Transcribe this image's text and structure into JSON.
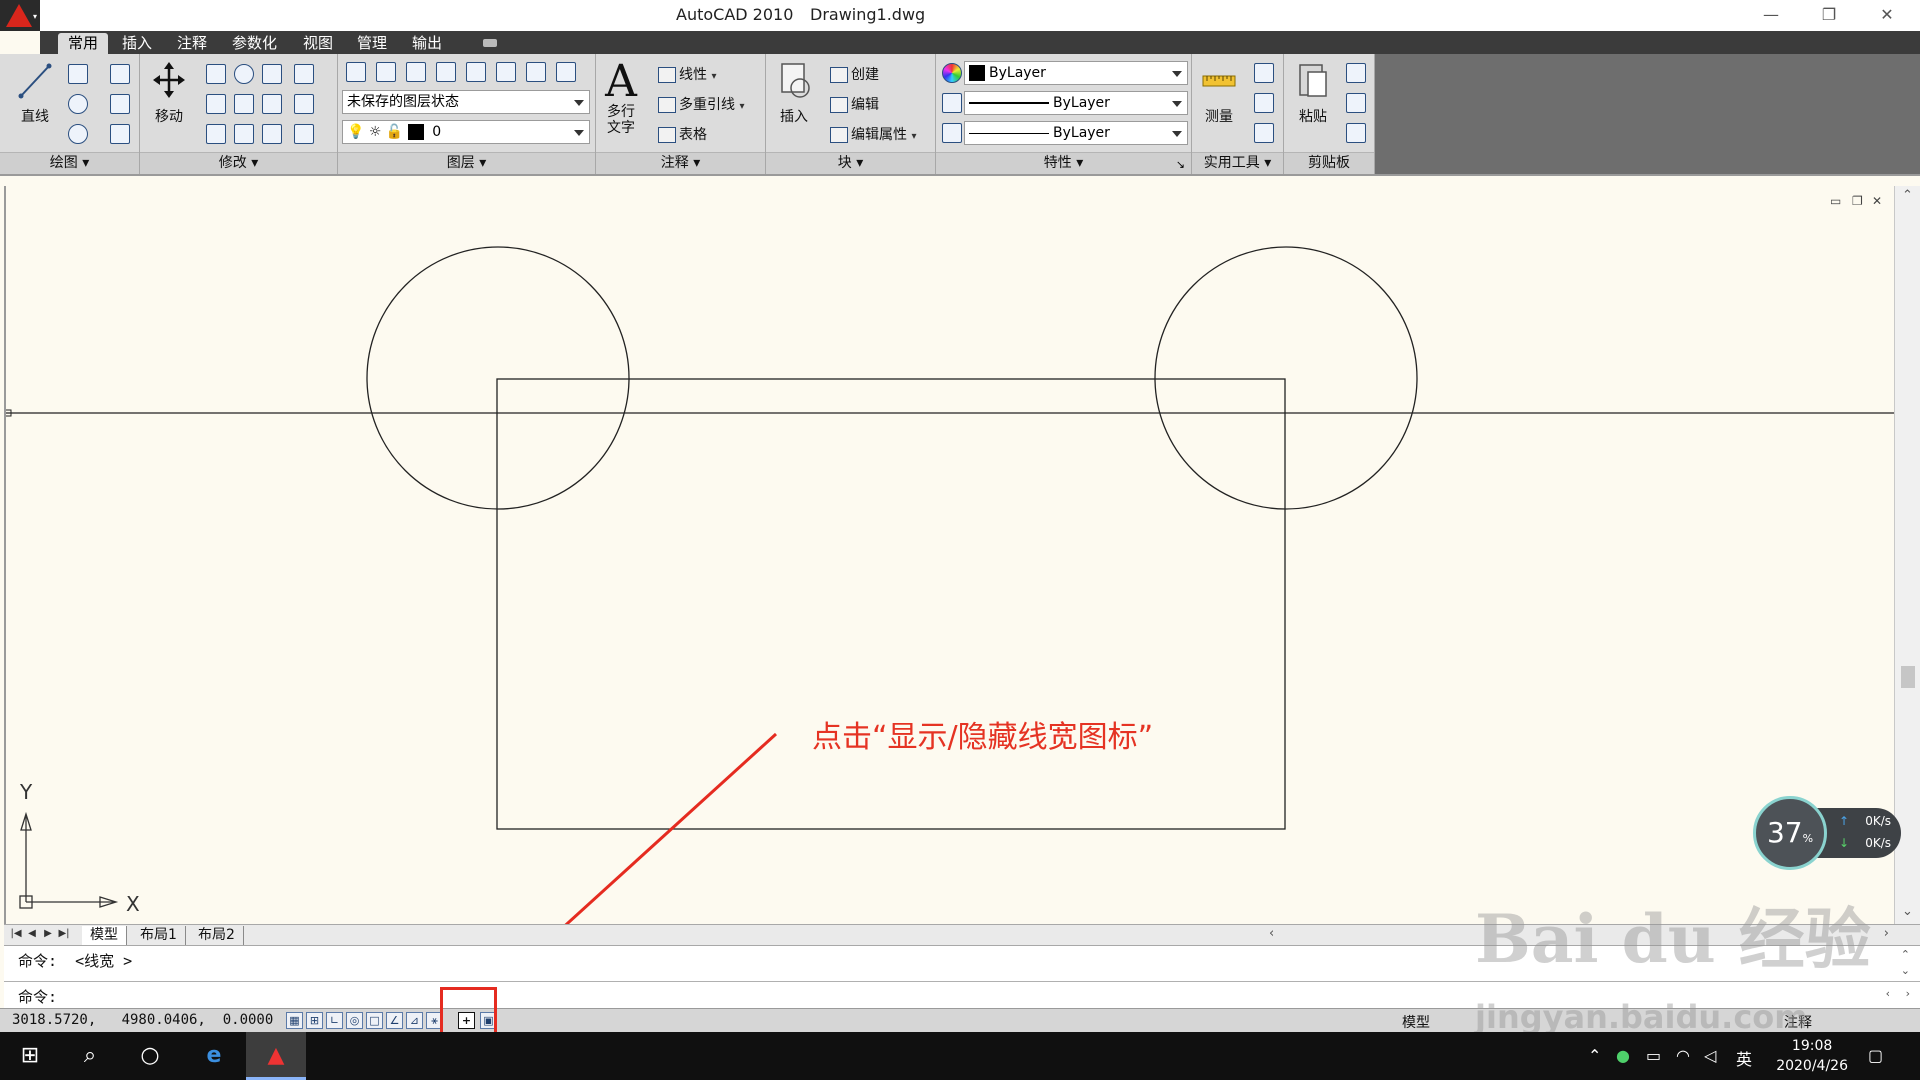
{
  "window": {
    "app_name": "AutoCAD 2010",
    "doc_name": "Drawing1.dwg",
    "minimize": "—",
    "restore": "❐",
    "close": "✕"
  },
  "ribbon_tabs": [
    "常用",
    "插入",
    "注释",
    "参数化",
    "视图",
    "管理",
    "输出"
  ],
  "ribbon": {
    "draw": {
      "title": "绘图 ▾",
      "line_label": "直线"
    },
    "modify": {
      "title": "修改 ▾",
      "move_label": "移动"
    },
    "layers": {
      "title": "图层 ▾",
      "layer_state": "未保存的图层状态",
      "layer_name": "0"
    },
    "annotation": {
      "title": "注释 ▾",
      "mtext_label1": "多行",
      "mtext_label2": "文字",
      "linear": "线性",
      "mleader": "多重引线",
      "table": "表格"
    },
    "block": {
      "title": "块 ▾",
      "insert": "插入",
      "create": "创建",
      "edit": "编辑",
      "edit_attr": "编辑属性"
    },
    "properties": {
      "title": "特性 ▾",
      "color": "ByLayer",
      "linetype": "ByLayer",
      "lineweight": "ByLayer",
      "corner": "↘"
    },
    "utilities": {
      "title": "实用工具 ▾",
      "measure": "测量"
    },
    "clipboard": {
      "title": "剪贴板",
      "paste": "粘贴"
    }
  },
  "viewport_controls": {
    "min": "▭",
    "restore": "❐",
    "close": "✕"
  },
  "axis": {
    "y": "Y",
    "x": "X"
  },
  "layout_tabs": {
    "model": "模型",
    "layout1": "布局1",
    "layout2": "布局2"
  },
  "command": {
    "history": "命令:  <线宽 >",
    "prompt": "命令:"
  },
  "status": {
    "coordinates": "3018.5720,   4980.0406,  0.0000",
    "model_label": "模型",
    "annotation_label": "注释",
    "buttons": [
      "▦",
      "⊞",
      "∟",
      "◎",
      "□",
      "∠",
      "⊿",
      "⚹",
      "+",
      "▣"
    ]
  },
  "annotation": {
    "callout": "点击“显示/隐藏线宽图标”"
  },
  "netmon": {
    "percent": "37",
    "percent_unit": "%",
    "up_speed": "0K/s",
    "down_speed": "0K/s"
  },
  "watermark": {
    "line1": "Bai du 经验",
    "line2": "jingyan.baidu.com"
  },
  "taskbar": {
    "ime": "英",
    "time": "19:08",
    "date": "2020/4/26"
  },
  "colors": {
    "canvas_bg": "#fdfaf0",
    "callout_red": "#e53323",
    "ribbon_tab_bg": "#3b3b3b"
  }
}
